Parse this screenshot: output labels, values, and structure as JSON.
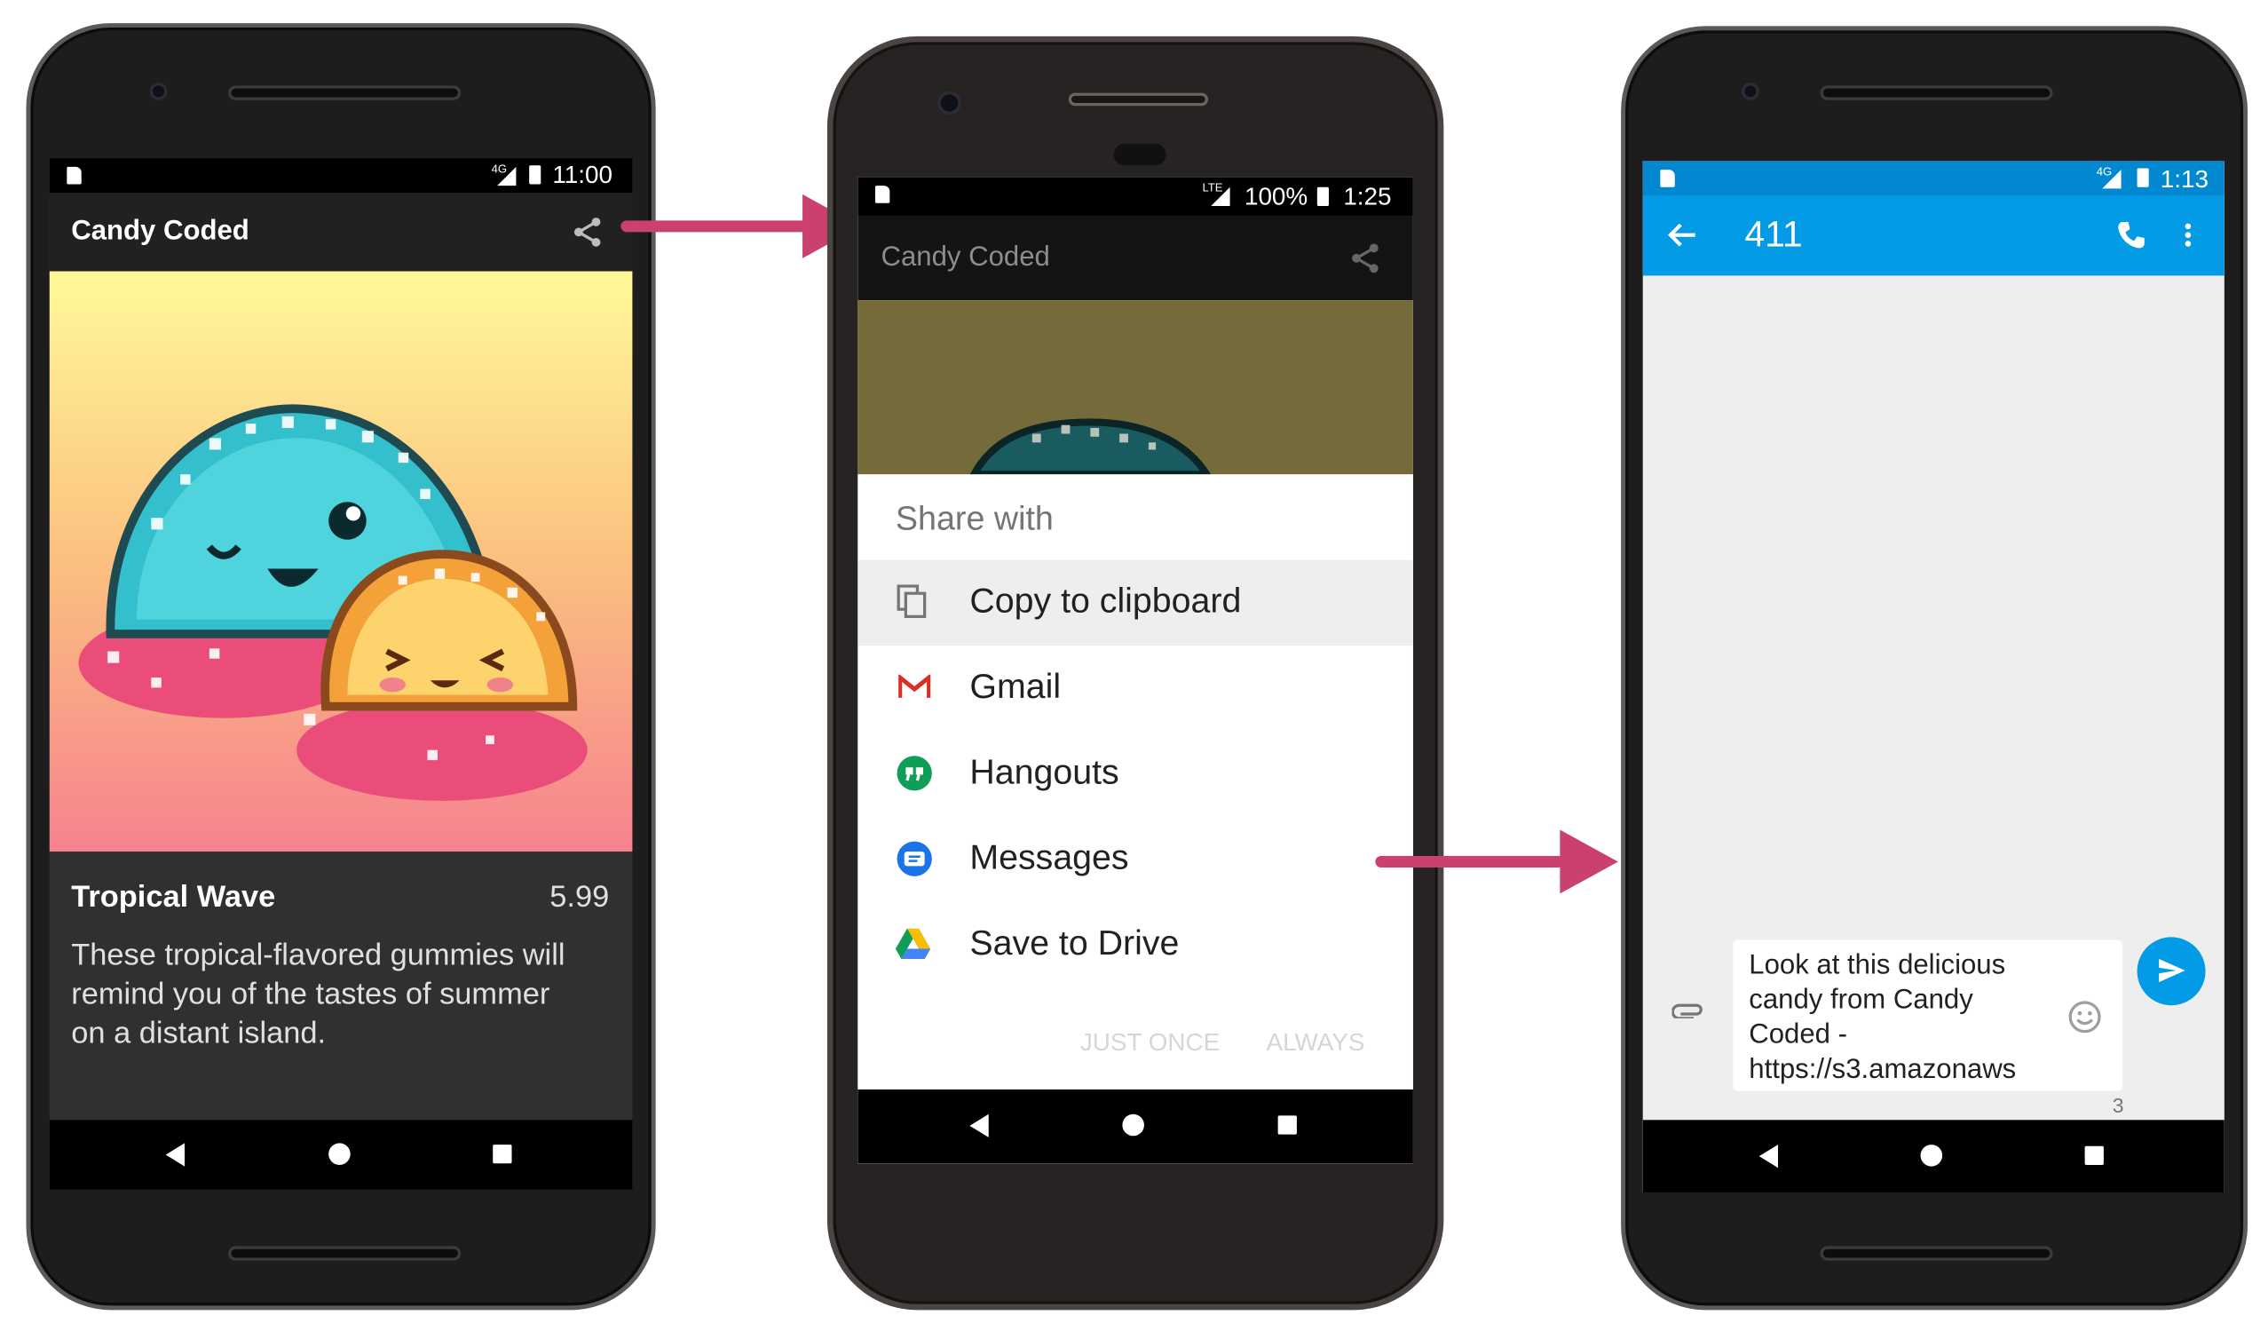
{
  "phone1": {
    "status_time": "11:00",
    "network": "4G",
    "app_title": "Candy Coded",
    "product_name": "Tropical Wave",
    "product_price": "5.99",
    "product_description": "These tropical-flavored gummies will remind you of the tastes of summer on a distant island.",
    "icons": [
      "share-icon",
      "back-icon",
      "home-icon",
      "recents-icon"
    ]
  },
  "phone2": {
    "status_time": "1:25",
    "network": "LTE",
    "battery": "100%",
    "app_title": "Candy Coded",
    "sheet_title": "Share with",
    "share_targets": [
      {
        "label": "Copy to clipboard",
        "icon": "clipboard-icon"
      },
      {
        "label": "Gmail",
        "icon": "gmail-icon"
      },
      {
        "label": "Hangouts",
        "icon": "hangouts-icon"
      },
      {
        "label": "Messages",
        "icon": "messages-icon"
      },
      {
        "label": "Save to Drive",
        "icon": "drive-icon"
      }
    ],
    "just_once_label": "JUST ONCE",
    "always_label": "ALWAYS"
  },
  "phone3": {
    "status_time": "1:13",
    "network": "4G",
    "recipient": "411",
    "message_text": "Look at this delicious candy from Candy Coded - https://s3.amazonaws",
    "char_count": "3",
    "icons": [
      "back-arrow-icon",
      "phone-icon",
      "more-vert-icon",
      "attach-icon",
      "emoji-icon",
      "send-icon"
    ]
  },
  "colors": {
    "arrow": "#c9416c",
    "messages_toolbar": "#039be5",
    "app_bar_dark": "#212121",
    "content_dark": "#303030",
    "product_gradient_top": "#fff99a",
    "product_gradient_bottom": "#f6828f"
  }
}
